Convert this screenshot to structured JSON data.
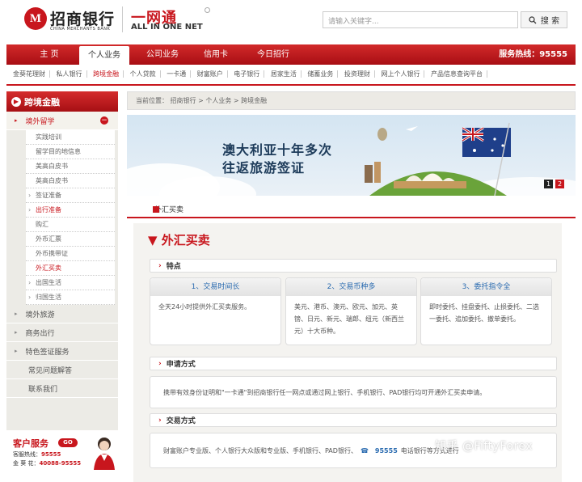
{
  "header": {
    "logo_glyph": "M",
    "bank_name": "招商银行",
    "bank_name_en": "CHINA MERCHANTS BANK",
    "ion_name": "一网通",
    "ion_name_en": "ALL IN ONE NET",
    "search_placeholder": "请输入关键字...",
    "search_button": "搜 索"
  },
  "nav": {
    "items": [
      "主 页",
      "个人业务",
      "公司业务",
      "信用卡",
      "今日招行"
    ],
    "active": 1,
    "hotline": "服务热线：95555"
  },
  "subnav": [
    "金葵花理财",
    "私人银行",
    "跨境金融",
    "个人贷款",
    "一卡通",
    "财富账户",
    "电子银行",
    "居家生活",
    "储蓄业务",
    "投资理财",
    "网上个人银行",
    "产品信息查询平台"
  ],
  "sidebar": {
    "title": "跨境金融",
    "section": "境外留学",
    "study_items": [
      "实践培训",
      "留学目的地信息",
      "美高白皮书",
      "英高白皮书"
    ],
    "visa": "签证准备",
    "travel": "出行准备",
    "travel_items": [
      "购汇",
      "外币汇票",
      "外币携带证",
      "外汇买卖"
    ],
    "abroad": "出国生活",
    "return": "归国生活",
    "main_items": [
      "境外旅游",
      "商务出行",
      "特色签证服务",
      "常见问题解答",
      "联系我们"
    ],
    "cs_title": "客户服务",
    "cs_go": "GO",
    "cs_line1_label": "客服热线：",
    "cs_line1_value": "95555",
    "cs_line2_label": "金 葵 花：",
    "cs_line2_value": "40088-95555"
  },
  "breadcrumb": "当前位置：  招商银行 > 个人业务 > 跨境金融",
  "banner": {
    "line1": "澳大利亚十年多次",
    "line2": "往返旅游签证",
    "pages": [
      "1",
      "2"
    ]
  },
  "section": {
    "title": "外汇买卖",
    "big_title": "外汇买卖",
    "features_label": "特点",
    "cards": [
      {
        "title": "1、交易时间长",
        "body": "全天24小时提供外汇买卖服务。"
      },
      {
        "title": "2、交易币种多",
        "body": "美元、港币、澳元、欧元、加元、英镑、日元、新元、瑞郎、纽元（新西兰元）十大币种。"
      },
      {
        "title": "3、委托指令全",
        "body": "即时委托、挂盘委托、止损委托、二选一委托、追加委托、撤单委托。"
      }
    ],
    "apply_label": "申请方式",
    "apply_text": "携带有效身份证明和\"一卡通\"到招商银行任一网点或通过网上银行、手机银行、PAD银行均可开通外汇买卖申请。",
    "trade_label": "交易方式",
    "trade_text": "财富账户专业版、个人银行大众版和专业版、手机银行、PAD银行、",
    "trade_phone": "95555",
    "trade_tail": "电话银行等方式进行"
  },
  "watermark": "知乎 @FiftyForex",
  "colors": {
    "brand_red": "#c8161d",
    "link_blue": "#2a6bb0"
  }
}
